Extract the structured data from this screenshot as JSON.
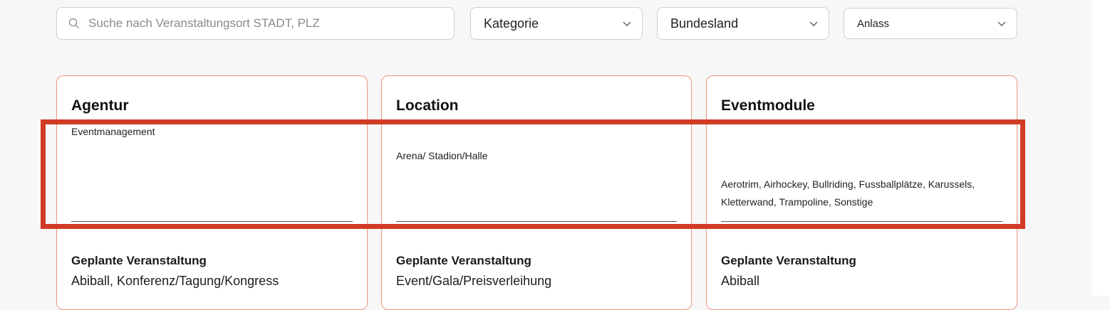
{
  "search": {
    "placeholder": "Suche nach Veranstaltungsort STADT, PLZ"
  },
  "filters": {
    "kategorie": "Kategorie",
    "bundesland": "Bundesland",
    "anlass": "Anlass"
  },
  "cards": [
    {
      "title": "Agentur",
      "subcategory": "Eventmanagement",
      "planned_label": "Geplante Veranstaltung",
      "planned_value": "Abiball, Konferenz/Tagung/Kongress"
    },
    {
      "title": "Location",
      "subcategory": "Arena/ Stadion/Halle",
      "planned_label": "Geplante Veranstaltung",
      "planned_value": "Event/Gala/Preisverleihung"
    },
    {
      "title": "Eventmodule",
      "subcategory": "Aerotrim, Airhockey, Bullriding, Fussballplätze, Karussels, Kletterwand, Trampoline, Sonstige",
      "planned_label": "Geplante Veranstaltung",
      "planned_value": "Abiball"
    }
  ],
  "colors": {
    "card_border": "#e8987a",
    "highlight": "#d13b24",
    "page_bg": "#f7f7f7"
  }
}
